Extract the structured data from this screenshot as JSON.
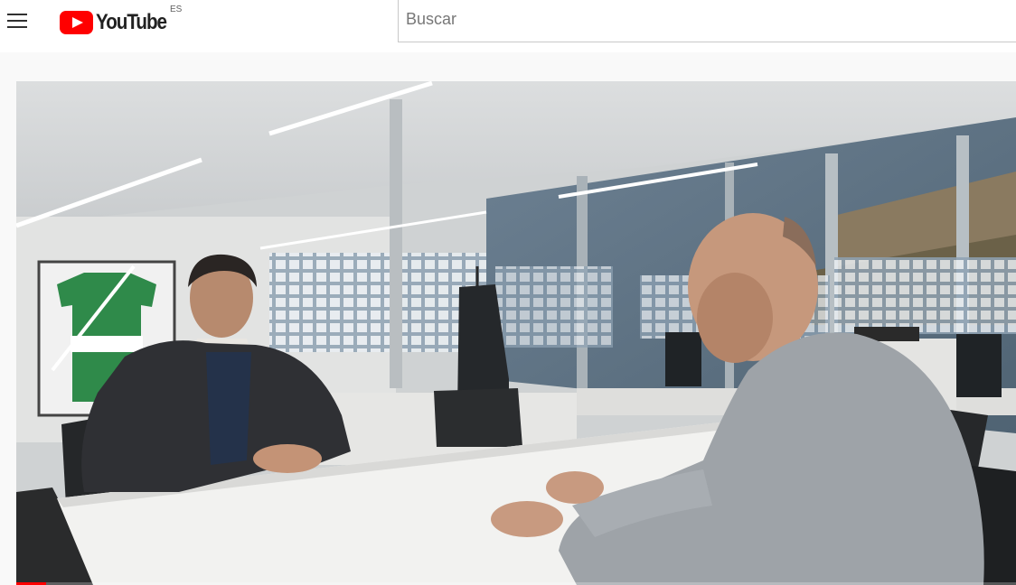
{
  "header": {
    "menu_icon": "hamburger-menu-icon",
    "logo_text": "YouTube",
    "logo_icon": "youtube-play-icon",
    "region_code": "ES",
    "search_placeholder": "Buscar",
    "search_value": ""
  },
  "player": {
    "content": "video-frame",
    "progress": 0.01
  },
  "colors": {
    "brand_red": "#ff0000",
    "masthead_bg": "#ffffff",
    "page_bg": "#f9f9f9"
  }
}
